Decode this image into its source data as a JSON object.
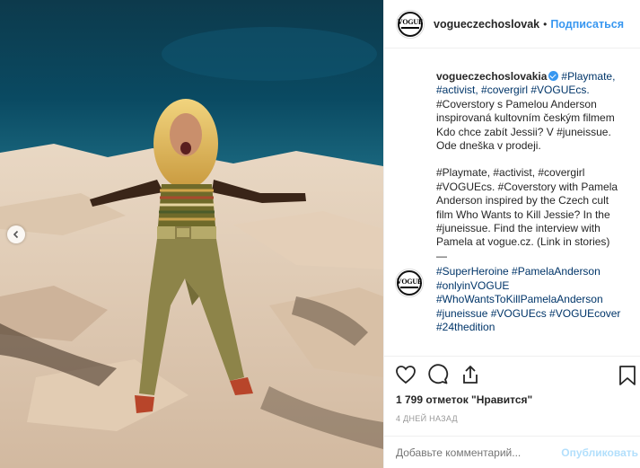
{
  "post": {
    "username": "vogueczechoslovak",
    "follow_label": "Подписаться",
    "avatar_logo": "VOGUE"
  },
  "caption": {
    "username": "vogueczechoslovakia",
    "paragraph1_lines": [
      "#Playmate,",
      "#activist, #covergirl #VOGUEcs.",
      "#Coverstory s Pamelou Anderson",
      "inspirovaná kultovním českým filmem",
      "Kdo chce zabít Jessii? V #juneissue.",
      "Ode dneška v prodeji."
    ],
    "paragraph2_lines": [
      "#Playmate, #activist, #covergirl",
      "#VOGUEcs. #Coverstory with Pamela",
      "Anderson inspired by the Czech cult",
      "film Who Wants to Kill Jessie? In the",
      "#juneissue. Find the interview with",
      "Pamela at vogue.cz. (Link in stories)"
    ],
    "separator": "—"
  },
  "comment": {
    "lines": [
      "#SuperHeroine #PamelaAnderson",
      "#onlyinVOGUE",
      "#WhoWantsToKillPamelaAnderson",
      "#juneissue #VOGUEcs #VOGUEcover",
      "#24thedition"
    ]
  },
  "actions": {
    "like_icon": "heart-icon",
    "comment_icon": "speech-bubble-icon",
    "share_icon": "share-icon",
    "save_icon": "bookmark-icon"
  },
  "likes_label": "1 799 отметок \"Нравится\"",
  "time_label": "4 ДНЕЙ НАЗАД",
  "add_comment": {
    "placeholder": "Добавьте комментарий...",
    "publish_label": "Опубликовать"
  },
  "colors": {
    "accent": "#3897f0",
    "hashtag": "#003569",
    "publish_disabled": "#b2dffc"
  }
}
